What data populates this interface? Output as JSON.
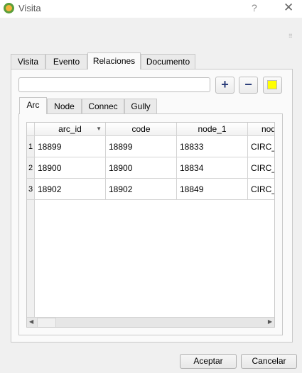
{
  "window": {
    "title": "Visita",
    "help": "?",
    "close": "✕"
  },
  "tabs": [
    {
      "label": "Visita"
    },
    {
      "label": "Evento"
    },
    {
      "label": "Relaciones",
      "active": true
    },
    {
      "label": "Documento"
    }
  ],
  "toolbar": {
    "search_value": "",
    "add": "+",
    "remove": "−"
  },
  "subtabs": [
    {
      "label": "Arc",
      "active": true
    },
    {
      "label": "Node"
    },
    {
      "label": "Connec"
    },
    {
      "label": "Gully"
    }
  ],
  "table": {
    "columns": [
      "arc_id",
      "code",
      "node_1",
      "nod"
    ],
    "rows": [
      {
        "n": "1",
        "cells": [
          "18899",
          "18899",
          "18833",
          "CIRC_N"
        ]
      },
      {
        "n": "2",
        "cells": [
          "18900",
          "18900",
          "18834",
          "CIRC_N"
        ]
      },
      {
        "n": "3",
        "cells": [
          "18902",
          "18902",
          "18849",
          "CIRC_N"
        ]
      }
    ]
  },
  "footer": {
    "ok": "Aceptar",
    "cancel": "Cancelar"
  }
}
